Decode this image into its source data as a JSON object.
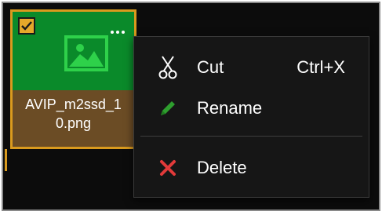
{
  "file_tile": {
    "filename": "AVIP_m2ssd_1\n0.png",
    "selected": true,
    "thumbnail_icon": "image-icon",
    "more_icon": "more-options-icon"
  },
  "context_menu": {
    "items": [
      {
        "label": "Cut",
        "shortcut": "Ctrl+X",
        "icon": "scissors-icon"
      },
      {
        "label": "Rename",
        "shortcut": "",
        "icon": "pencil-icon"
      },
      {
        "label": "Delete",
        "shortcut": "",
        "icon": "close-x-icon"
      }
    ]
  },
  "colors": {
    "background": "#0c0c0c",
    "selection_accent": "#d99a1e",
    "thumbnail_bg": "#0a8a2a",
    "rename_icon": "#2e9e2e",
    "delete_icon": "#e23a3a"
  }
}
